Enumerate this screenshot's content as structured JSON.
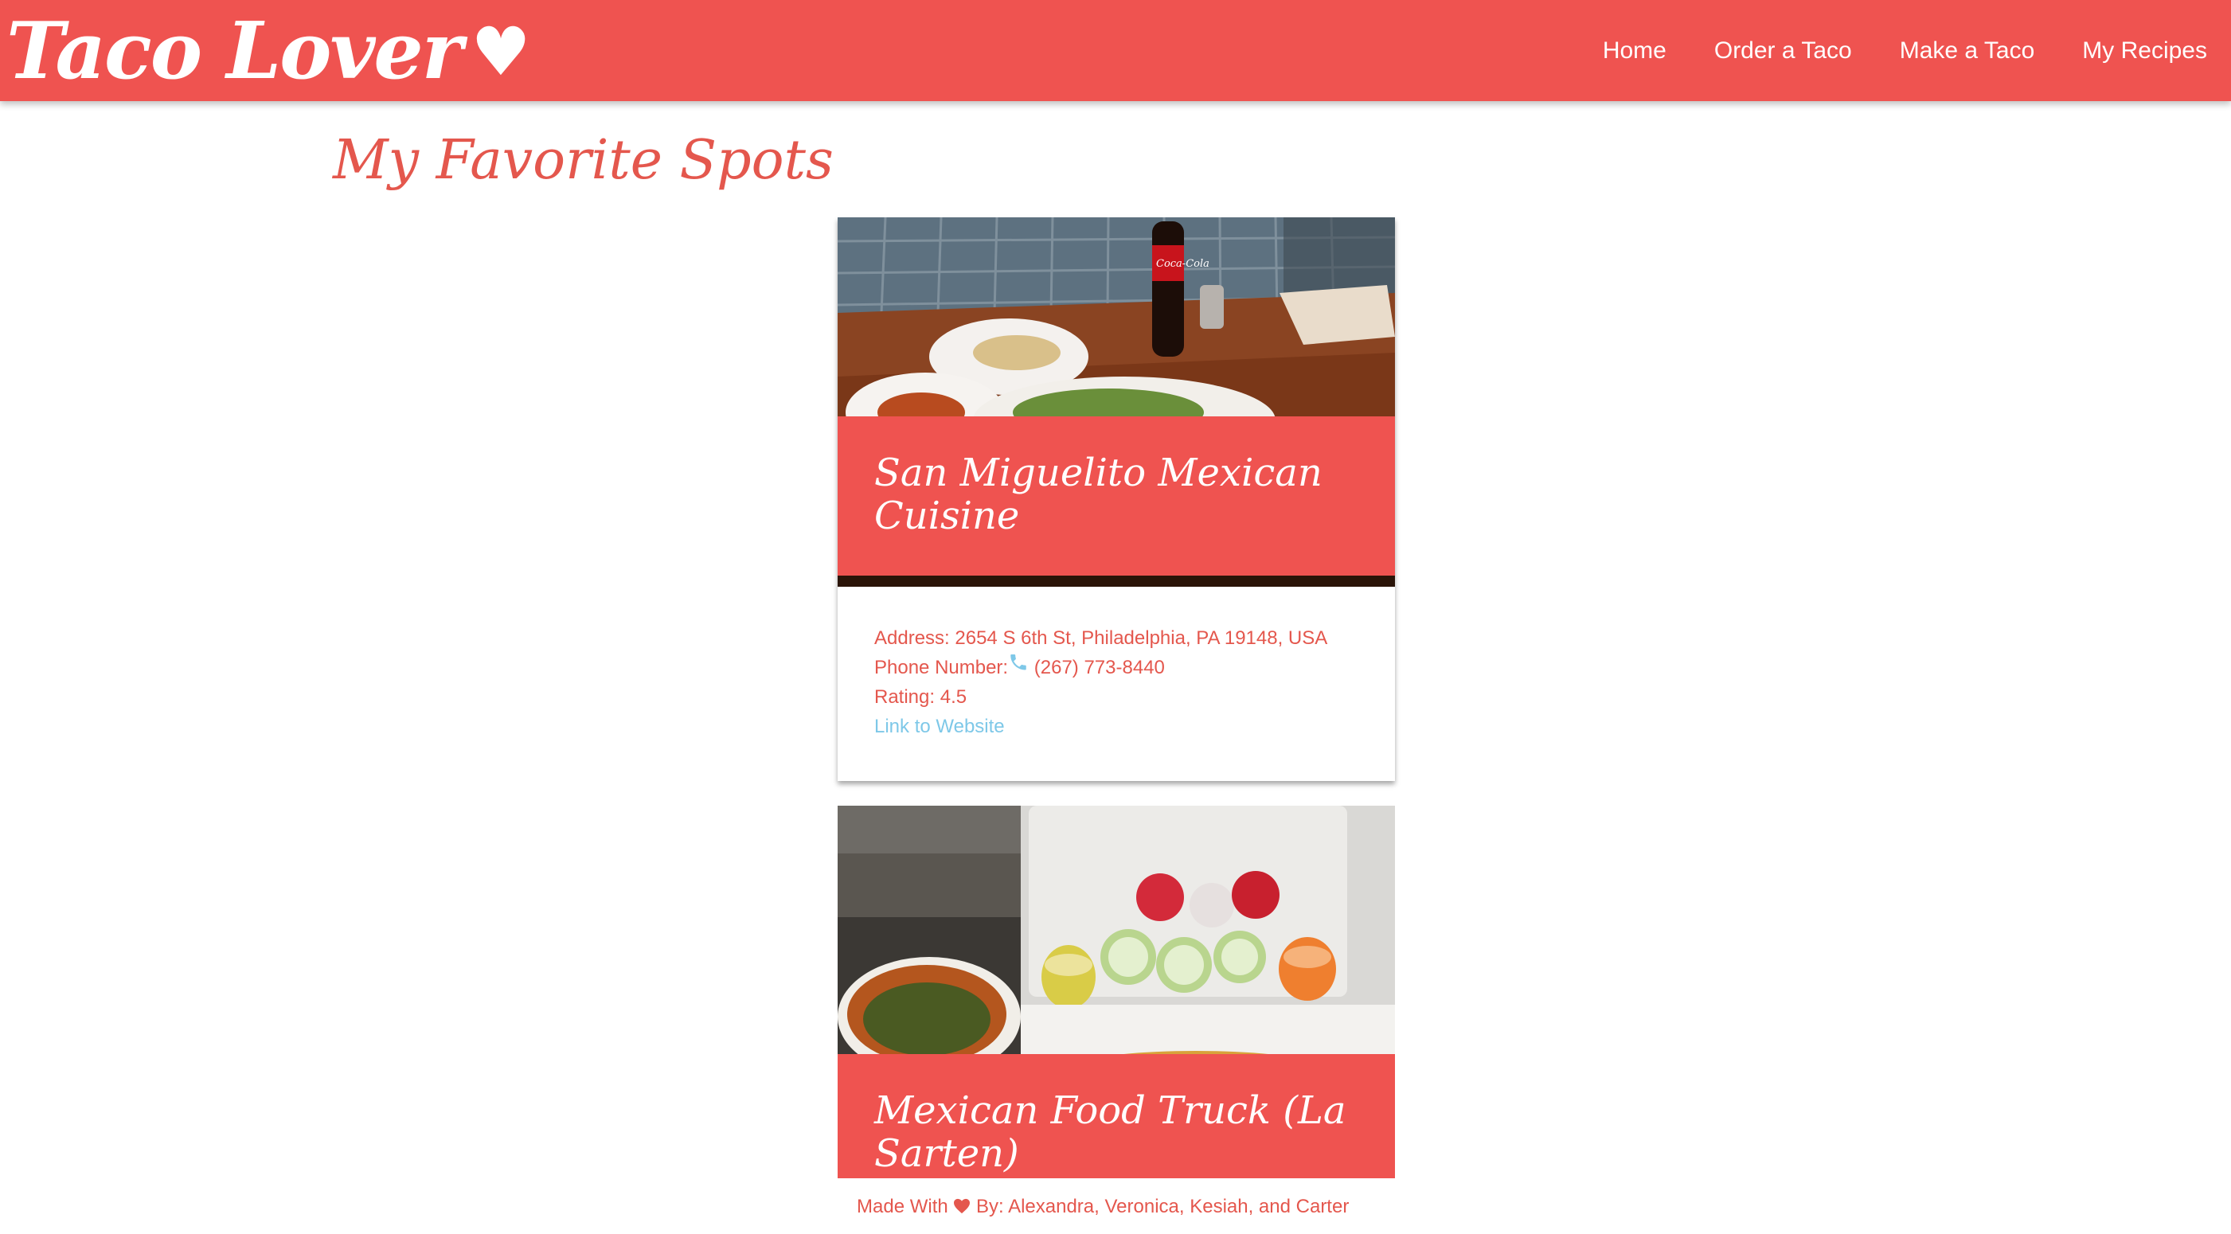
{
  "header": {
    "brand": "Taco Lover",
    "brand_icon": "heart-icon",
    "nav": [
      {
        "label": "Home"
      },
      {
        "label": "Order a Taco"
      },
      {
        "label": "Make a Taco"
      },
      {
        "label": "My Recipes"
      }
    ]
  },
  "page": {
    "title": "My Favorite Spots"
  },
  "cards": [
    {
      "title": "San Miguelito Mexican Cuisine",
      "address_label": "Address:",
      "address": "2654 S 6th St, Philadelphia, PA 19148, USA",
      "phone_label": "Phone Number:",
      "phone_icon": "phone-icon",
      "phone": "(267) 773-8440",
      "rating_label": "Rating:",
      "rating": "4.5",
      "link_label": "Link to Website"
    },
    {
      "title": "Mexican Food Truck (La Sarten)"
    }
  ],
  "footer": {
    "prefix": "Made With",
    "heart_icon": "heart-icon",
    "suffix": "By: Alexandra, Veronica, Kesiah, and Carter"
  },
  "colors": {
    "brand_red": "#ef5350",
    "text_red": "#e4574d",
    "link_blue": "#7ec8e8"
  }
}
